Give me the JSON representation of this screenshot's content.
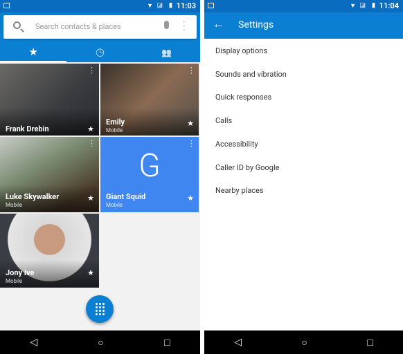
{
  "left": {
    "status": {
      "time": "11:03"
    },
    "search": {
      "placeholder": "Search contacts & places"
    },
    "tabs": [
      {
        "icon": "star-icon",
        "glyph": "★"
      },
      {
        "icon": "clock-icon",
        "glyph": "◷"
      },
      {
        "icon": "people-icon",
        "glyph": "👥"
      }
    ],
    "contacts": [
      {
        "name": "Frank Drebin",
        "sub": ""
      },
      {
        "name": "Emily",
        "sub": "Mobile"
      },
      {
        "name": "Luke Skywalker",
        "sub": "Mobile"
      },
      {
        "name": "Giant Squid",
        "sub": "Mobile",
        "letter": "G"
      },
      {
        "name": "Jony Ive",
        "sub": "Mobile"
      }
    ]
  },
  "right": {
    "status": {
      "time": "11:04"
    },
    "title": "Settings",
    "items": [
      "Display options",
      "Sounds and vibration",
      "Quick responses",
      "Calls",
      "Accessibility",
      "Caller ID by Google",
      "Nearby places"
    ]
  },
  "colors": {
    "primary": "#0b7fd1",
    "status": "#0a6cbf",
    "tile": "#3f86f0"
  },
  "nav": {
    "back": "◁",
    "home": "○",
    "recent": "□"
  }
}
